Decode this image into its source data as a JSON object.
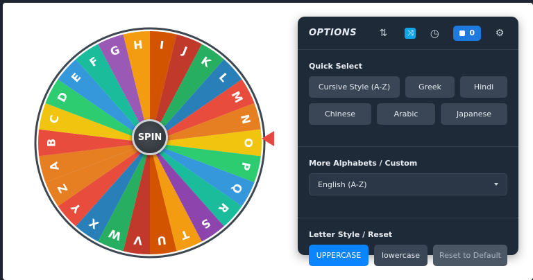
{
  "wheel": {
    "letters": [
      "A",
      "B",
      "C",
      "D",
      "E",
      "F",
      "G",
      "H",
      "I",
      "J",
      "K",
      "L",
      "M",
      "N",
      "O",
      "P",
      "Q",
      "R",
      "S",
      "T",
      "U",
      "V",
      "W",
      "X",
      "Y",
      "Z"
    ],
    "segment_colors": [
      "#e67e22",
      "#e74c3c",
      "#f1c40f",
      "#2ecc71",
      "#3498db",
      "#1abc9c",
      "#9b59b6",
      "#f39c12",
      "#d35400",
      "#c0392b",
      "#27ae60",
      "#2980b9",
      "#e74c3c",
      "#e67e22",
      "#f1c40f",
      "#2ecc71",
      "#3498db",
      "#1abc9c",
      "#8e44ad",
      "#f39c12",
      "#d35400",
      "#c0392b",
      "#27ae60",
      "#2980b9",
      "#e74c3c",
      "#e67e22"
    ],
    "spin_label": "SPIN",
    "pointer_color": "#e8473d"
  },
  "options": {
    "title": "OPTIONS",
    "counter": "0",
    "icons": [
      "sort-icon",
      "shuffle-icon",
      "history-icon",
      "counter-icon",
      "gear-icon"
    ]
  },
  "quick_select": {
    "label": "Quick Select",
    "row1": [
      "Cursive Style (A-Z)",
      "Greek",
      "Hindi"
    ],
    "row2": [
      "Chinese",
      "Arabic",
      "Japanese"
    ]
  },
  "more_alphabets": {
    "label": "More Alphabets / Custom",
    "selected": "English (A-Z)"
  },
  "letter_style": {
    "label": "Letter Style / Reset",
    "uppercase": "UPPERCASE",
    "lowercase": "lowercase",
    "reset": "Reset to Default"
  },
  "colors": {
    "accent": "#0a84ff",
    "panel": "#1f2a38"
  }
}
